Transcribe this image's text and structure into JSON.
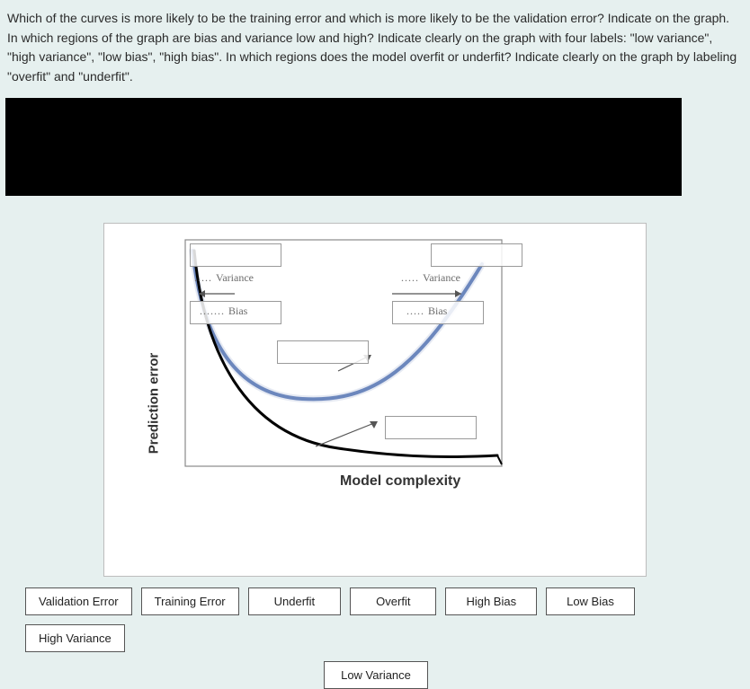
{
  "question_text": "Which of the curves is more likely to be the training error and which is more likely to be the validation error? Indicate on the graph. In which regions of the graph are bias and variance low and high? Indicate clearly on the graph with four labels: \"low variance\", \"high variance\", \"low bias\", \"high bias\". In which regions does the model overfit or underfit? Indicate clearly on the graph by labeling \"overfit\" and \"underfit\".",
  "chart": {
    "y_axis_label": "Prediction error",
    "x_axis_label": "Model complexity",
    "left_variance_label": "Variance",
    "left_bias_label": "Bias",
    "right_variance_label": "Variance",
    "right_bias_label": "Bias"
  },
  "options": {
    "validation_error": "Validation Error",
    "training_error": "Training Error",
    "underfit": "Underfit",
    "overfit": "Overfit",
    "high_bias": "High Bias",
    "low_bias": "Low Bias",
    "high_variance": "High Variance",
    "low_variance": "Low Variance"
  },
  "chart_data": {
    "type": "line",
    "xlabel": "Model complexity",
    "ylabel": "Prediction error",
    "x": [
      0,
      0.1,
      0.2,
      0.3,
      0.4,
      0.5,
      0.6,
      0.7,
      0.8,
      0.9,
      1.0
    ],
    "series": [
      {
        "name": "curve_A_u_shape",
        "color": "#3a5fa8",
        "values": [
          1.0,
          0.55,
          0.35,
          0.25,
          0.22,
          0.22,
          0.25,
          0.35,
          0.55,
          0.8,
          1.0
        ]
      },
      {
        "name": "curve_B_monotonic_decrease",
        "color": "#000",
        "values": [
          1.0,
          0.55,
          0.35,
          0.24,
          0.17,
          0.13,
          0.1,
          0.08,
          0.07,
          0.06,
          0.06
        ]
      }
    ],
    "note": "Axes are qualitative (no numeric ticks in source image); values are relative estimates on 0-1 scale."
  }
}
